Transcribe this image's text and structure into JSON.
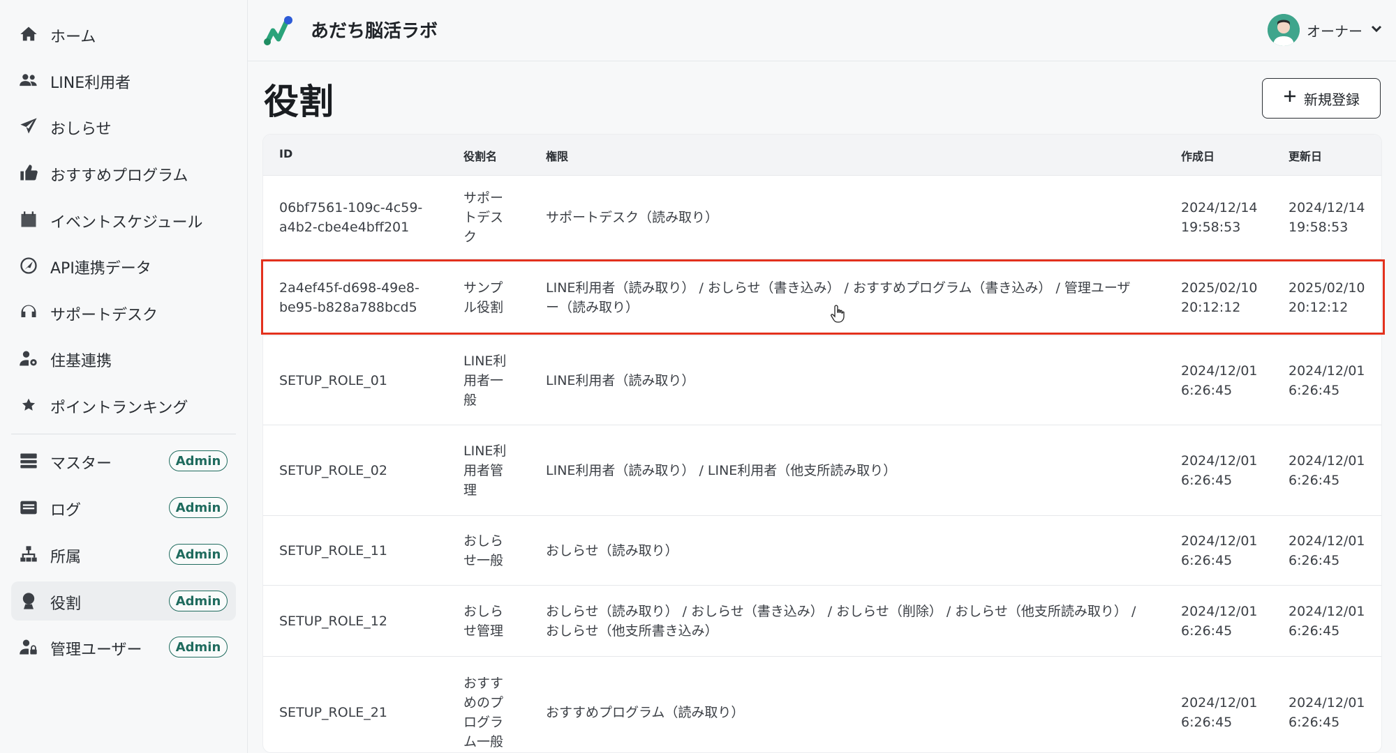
{
  "header": {
    "app_title": "あだち脳活ラボ",
    "user_name": "オーナー"
  },
  "sidebar": {
    "items": [
      {
        "label": "ホーム",
        "icon": "home-icon"
      },
      {
        "label": "LINE利用者",
        "icon": "users-icon"
      },
      {
        "label": "おしらせ",
        "icon": "paper-plane-icon"
      },
      {
        "label": "おすすめプログラム",
        "icon": "thumbs-up-icon"
      },
      {
        "label": "イベントスケジュール",
        "icon": "calendar-icon"
      },
      {
        "label": "API連携データ",
        "icon": "api-icon"
      },
      {
        "label": "サポートデスク",
        "icon": "headset-icon"
      },
      {
        "label": "住基連携",
        "icon": "user-gear-icon"
      },
      {
        "label": "ポイントランキング",
        "icon": "star-icon"
      }
    ],
    "admin_items": [
      {
        "label": "マスター",
        "badge": "Admin",
        "icon": "database-icon"
      },
      {
        "label": "ログ",
        "badge": "Admin",
        "icon": "log-icon"
      },
      {
        "label": "所属",
        "badge": "Admin",
        "icon": "org-chart-icon"
      },
      {
        "label": "役割",
        "badge": "Admin",
        "icon": "role-icon"
      },
      {
        "label": "管理ユーザー",
        "badge": "Admin",
        "icon": "user-lock-icon"
      }
    ]
  },
  "main": {
    "title": "役割",
    "new_button_label": "新規登録",
    "columns": [
      "ID",
      "役割名",
      "権限",
      "作成日",
      "更新日"
    ],
    "rows": [
      {
        "id": "06bf7561-109c-4c59-\na4b2-cbe4e4bff201",
        "name": "サポー\nトデス\nク",
        "perms": "サポートデスク（読み取り）",
        "created": "2024/12/14\n19:58:53",
        "updated": "2024/12/14\n19:58:53"
      },
      {
        "id": "2a4ef45f-d698-49e8-\nbe95-b828a788bcd5",
        "name": "サンプ\nル役割",
        "perms": "LINE利用者（読み取り） / おしらせ（書き込み） / おすすめプログラム（書き込み） / 管理ユーザ\nー（読み取り）",
        "created": "2025/02/10\n20:12:12",
        "updated": "2025/02/10\n20:12:12"
      },
      {
        "id": "SETUP_ROLE_01",
        "name": "LINE利\n用者一\n般",
        "perms": "LINE利用者（読み取り）",
        "created": "2024/12/01\n6:26:45",
        "updated": "2024/12/01\n6:26:45"
      },
      {
        "id": "SETUP_ROLE_02",
        "name": "LINE利\n用者管\n理",
        "perms": "LINE利用者（読み取り） / LINE利用者（他支所読み取り）",
        "created": "2024/12/01\n6:26:45",
        "updated": "2024/12/01\n6:26:45"
      },
      {
        "id": "SETUP_ROLE_11",
        "name": "おしら\nせ一般",
        "perms": "おしらせ（読み取り）",
        "created": "2024/12/01\n6:26:45",
        "updated": "2024/12/01\n6:26:45"
      },
      {
        "id": "SETUP_ROLE_12",
        "name": "おしら\nせ管理",
        "perms": "おしらせ（読み取り） / おしらせ（書き込み） / おしらせ（削除） / おしらせ（他支所読み取り） /\nおしらせ（他支所書き込み）",
        "created": "2024/12/01\n6:26:45",
        "updated": "2024/12/01\n6:26:45"
      },
      {
        "id": "SETUP_ROLE_21",
        "name": "おすす\nめのプ\nログラ\nム一般",
        "perms": "おすすめプログラム（読み取り）",
        "created": "2024/12/01\n6:26:45",
        "updated": "2024/12/01\n6:26:45"
      }
    ]
  },
  "colors": {
    "accent": "#1f6b5e",
    "highlight": "#e3311d",
    "logo_green": "#2aa37a",
    "logo_blue": "#2d5bd7"
  }
}
